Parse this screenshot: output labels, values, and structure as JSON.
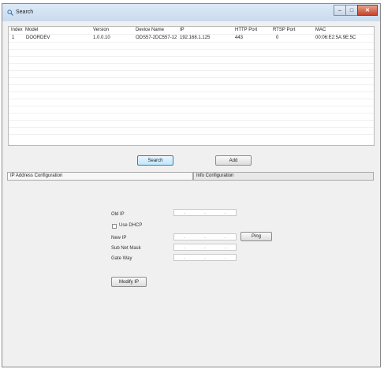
{
  "window": {
    "title": "Search",
    "minimize_glyph": "–",
    "maximize_glyph": "□",
    "close_glyph": "✕"
  },
  "table": {
    "columns": [
      "Index",
      "Model",
      "Version",
      "Device Name",
      "IP",
      "HTTP Port",
      "RTSP Port",
      "MAC"
    ],
    "rows": [
      [
        "1",
        "DOORDEV",
        "1.0.0.10",
        "ODS57-2DC557-12",
        "192.168.1.125",
        "443",
        "0",
        "00:06:E2:5A:9E:5C"
      ]
    ]
  },
  "buttons": {
    "search": "Search",
    "add": "Add",
    "ping": "Ping",
    "modify_ip": "Modify IP"
  },
  "sections": {
    "ip_config": "IP Address Configuration",
    "info_config": "Info Configuration"
  },
  "form": {
    "old_ip_label": "Old IP",
    "use_dhcp_label": "Use DHCP",
    "new_ip_label": "New IP",
    "subnet_mask_label": "Sub Net Mask",
    "gateway_label": "Gate Way",
    "ip_dot": "."
  }
}
